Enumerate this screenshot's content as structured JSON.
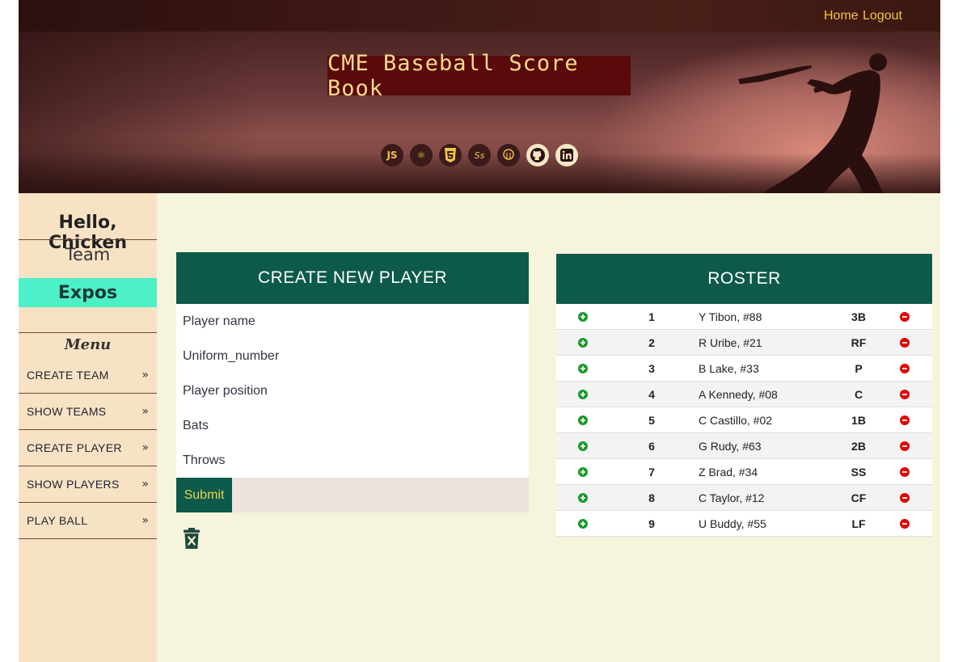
{
  "nav": {
    "home": "Home",
    "logout": "Logout"
  },
  "hero": {
    "title": "CME Baseball Score Book",
    "tech_icons": [
      {
        "name": "javascript-icon",
        "glyph": "JS"
      },
      {
        "name": "react-icon",
        "glyph": "⚛"
      },
      {
        "name": "html5-icon",
        "glyph": "5"
      },
      {
        "name": "sass-icon",
        "glyph": "Ss"
      },
      {
        "name": "postgresql-icon",
        "glyph": "🐘"
      },
      {
        "name": "github-icon",
        "glyph": "●"
      },
      {
        "name": "linkedin-icon",
        "glyph": "in"
      }
    ]
  },
  "sidebar": {
    "greeting": "Hello, Chicken",
    "team_label": "Team",
    "team_name": "Expos",
    "menu_title": "Menu",
    "items": [
      {
        "label": "CREATE TEAM"
      },
      {
        "label": "SHOW TEAMS"
      },
      {
        "label": "CREATE PLAYER"
      },
      {
        "label": "SHOW PLAYERS"
      },
      {
        "label": "PLAY BALL"
      }
    ]
  },
  "form": {
    "title": "CREATE NEW PLAYER",
    "fields": {
      "player_name": "Player name",
      "uniform_number": "Uniform_number",
      "player_position": "Player position",
      "bats": "Bats",
      "throws": "Throws"
    },
    "submit": "Submit"
  },
  "roster": {
    "title": "ROSTER",
    "rows": [
      {
        "order": "1",
        "player": "Y Tibon, #88",
        "position": "3B"
      },
      {
        "order": "2",
        "player": "R Uribe, #21",
        "position": "RF"
      },
      {
        "order": "3",
        "player": "B Lake, #33",
        "position": "P"
      },
      {
        "order": "4",
        "player": "A Kennedy, #08",
        "position": "C"
      },
      {
        "order": "5",
        "player": "C Castillo, #02",
        "position": "1B"
      },
      {
        "order": "6",
        "player": "G Rudy, #63",
        "position": "2B"
      },
      {
        "order": "7",
        "player": "Z Brad, #34",
        "position": "SS"
      },
      {
        "order": "8",
        "player": "C Taylor, #12",
        "position": "CF"
      },
      {
        "order": "9",
        "player": "U Buddy, #55",
        "position": "LF"
      }
    ]
  },
  "colors": {
    "nav_link": "#f1c646",
    "card_header": "#0e5a4a",
    "team_highlight": "#4cf0c7",
    "sidebar_bg": "#f7e3c4",
    "main_bg": "#f6f4dc",
    "add_icon": "#1a9a2a",
    "remove_icon": "#e00000"
  }
}
